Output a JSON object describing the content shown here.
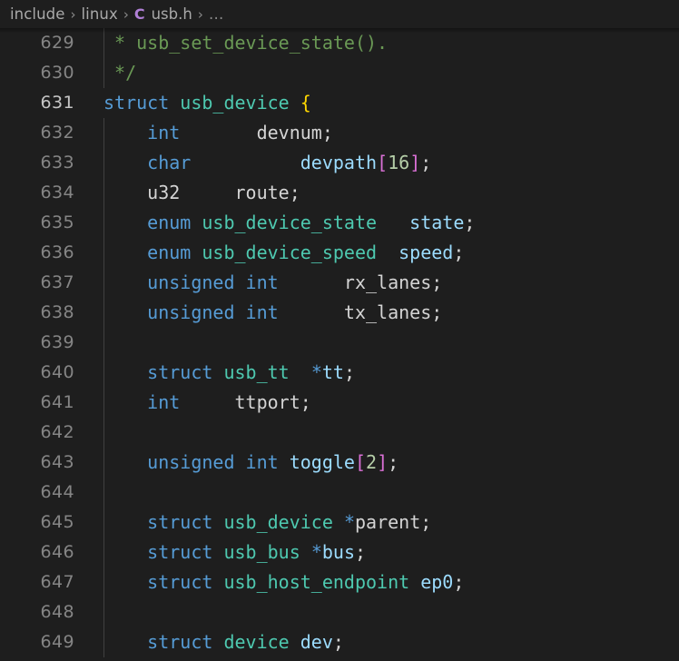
{
  "window": {
    "title": "usb.h — Visual Studio Code",
    "theme": "Dark+ (default dark)",
    "language": "C"
  },
  "breadcrumb": {
    "name": "breadcrumb",
    "separator": "›",
    "items": [
      {
        "label": "include",
        "icon": null
      },
      {
        "label": "linux",
        "icon": null
      },
      {
        "label": "usb.h",
        "icon": "c-file-icon"
      },
      {
        "label": "…",
        "icon": null
      }
    ]
  },
  "colors": {
    "editor_background": "#1e1e1e",
    "breadcrumb_background": "#1e1e1e",
    "line_number": "#858585",
    "line_number_active": "#c6c6c6",
    "indent_guide": "#404040",
    "comment": "#6a9955",
    "keyword": "#569cd6",
    "type": "#4ec9b0",
    "variable": "#9cdcfe",
    "plain_text": "#d4d4d4",
    "number": "#b5cea8",
    "bracket_level_1": "#ffd700",
    "bracket_level_2": "#da70d6",
    "c_file_icon": "#b180d7"
  },
  "editor": {
    "name": "code-editor",
    "file": "usb.h",
    "first_visible_line": 629,
    "last_visible_line": 649,
    "active_line": 631,
    "lines": [
      {
        "number": 629,
        "indent_guide": true,
        "text": " * usb_set_device_state().",
        "tokens": [
          {
            "t": " * usb_set_device_state().",
            "c": "t-comment"
          }
        ]
      },
      {
        "number": 630,
        "indent_guide": true,
        "text": " */",
        "tokens": [
          {
            "t": " */",
            "c": "t-comment"
          }
        ]
      },
      {
        "number": 631,
        "indent_guide": false,
        "text": "struct usb_device {",
        "tokens": [
          {
            "t": "struct",
            "c": "t-keyword"
          },
          {
            "t": " ",
            "c": "t-plain"
          },
          {
            "t": "usb_device",
            "c": "t-type"
          },
          {
            "t": " ",
            "c": "t-plain"
          },
          {
            "t": "{",
            "c": "t-brk1"
          }
        ]
      },
      {
        "number": 632,
        "indent_guide": true,
        "text": "    int\t\tdevnum;",
        "tokens": [
          {
            "t": "    ",
            "c": "t-plain"
          },
          {
            "t": "int",
            "c": "t-keyword"
          },
          {
            "t": "       ",
            "c": "t-plain"
          },
          {
            "t": "devnum",
            "c": "t-plain"
          },
          {
            "t": ";",
            "c": "t-punc"
          }
        ]
      },
      {
        "number": 633,
        "indent_guide": true,
        "text": "    char\t\tdevpath[16];",
        "tokens": [
          {
            "t": "    ",
            "c": "t-plain"
          },
          {
            "t": "char",
            "c": "t-keyword"
          },
          {
            "t": "          ",
            "c": "t-plain"
          },
          {
            "t": "devpath",
            "c": "t-var"
          },
          {
            "t": "[",
            "c": "t-brk2"
          },
          {
            "t": "16",
            "c": "t-num"
          },
          {
            "t": "]",
            "c": "t-brk2"
          },
          {
            "t": ";",
            "c": "t-punc"
          }
        ]
      },
      {
        "number": 634,
        "indent_guide": true,
        "text": "    u32\t\troute;",
        "tokens": [
          {
            "t": "    ",
            "c": "t-plain"
          },
          {
            "t": "u32",
            "c": "t-plain"
          },
          {
            "t": "     ",
            "c": "t-plain"
          },
          {
            "t": "route",
            "c": "t-plain"
          },
          {
            "t": ";",
            "c": "t-punc"
          }
        ]
      },
      {
        "number": 635,
        "indent_guide": true,
        "text": "    enum usb_device_state\tstate;",
        "tokens": [
          {
            "t": "    ",
            "c": "t-plain"
          },
          {
            "t": "enum",
            "c": "t-keyword"
          },
          {
            "t": " ",
            "c": "t-plain"
          },
          {
            "t": "usb_device_state",
            "c": "t-type"
          },
          {
            "t": "   ",
            "c": "t-plain"
          },
          {
            "t": "state",
            "c": "t-var"
          },
          {
            "t": ";",
            "c": "t-punc"
          }
        ]
      },
      {
        "number": 636,
        "indent_guide": true,
        "text": "    enum usb_device_speed\tspeed;",
        "tokens": [
          {
            "t": "    ",
            "c": "t-plain"
          },
          {
            "t": "enum",
            "c": "t-keyword"
          },
          {
            "t": " ",
            "c": "t-plain"
          },
          {
            "t": "usb_device_speed",
            "c": "t-type"
          },
          {
            "t": "  ",
            "c": "t-plain"
          },
          {
            "t": "speed",
            "c": "t-var"
          },
          {
            "t": ";",
            "c": "t-punc"
          }
        ]
      },
      {
        "number": 637,
        "indent_guide": true,
        "text": "    unsigned int\t\trx_lanes;",
        "tokens": [
          {
            "t": "    ",
            "c": "t-plain"
          },
          {
            "t": "unsigned int",
            "c": "t-keyword"
          },
          {
            "t": "      ",
            "c": "t-plain"
          },
          {
            "t": "rx_lanes",
            "c": "t-plain"
          },
          {
            "t": ";",
            "c": "t-punc"
          }
        ]
      },
      {
        "number": 638,
        "indent_guide": true,
        "text": "    unsigned int\t\ttx_lanes;",
        "tokens": [
          {
            "t": "    ",
            "c": "t-plain"
          },
          {
            "t": "unsigned int",
            "c": "t-keyword"
          },
          {
            "t": "      ",
            "c": "t-plain"
          },
          {
            "t": "tx_lanes",
            "c": "t-plain"
          },
          {
            "t": ";",
            "c": "t-punc"
          }
        ]
      },
      {
        "number": 639,
        "indent_guide": true,
        "text": "",
        "tokens": []
      },
      {
        "number": 640,
        "indent_guide": true,
        "text": "    struct usb_tt\t*tt;",
        "tokens": [
          {
            "t": "    ",
            "c": "t-plain"
          },
          {
            "t": "struct",
            "c": "t-keyword"
          },
          {
            "t": " ",
            "c": "t-plain"
          },
          {
            "t": "usb_tt",
            "c": "t-type"
          },
          {
            "t": "  ",
            "c": "t-plain"
          },
          {
            "t": "*",
            "c": "t-keyword"
          },
          {
            "t": "tt",
            "c": "t-var"
          },
          {
            "t": ";",
            "c": "t-punc"
          }
        ]
      },
      {
        "number": 641,
        "indent_guide": true,
        "text": "    int\t\tttport;",
        "tokens": [
          {
            "t": "    ",
            "c": "t-plain"
          },
          {
            "t": "int",
            "c": "t-keyword"
          },
          {
            "t": "     ",
            "c": "t-plain"
          },
          {
            "t": "ttport",
            "c": "t-plain"
          },
          {
            "t": ";",
            "c": "t-punc"
          }
        ]
      },
      {
        "number": 642,
        "indent_guide": true,
        "text": "",
        "tokens": []
      },
      {
        "number": 643,
        "indent_guide": true,
        "text": "    unsigned int toggle[2];",
        "tokens": [
          {
            "t": "    ",
            "c": "t-plain"
          },
          {
            "t": "unsigned int",
            "c": "t-keyword"
          },
          {
            "t": " ",
            "c": "t-plain"
          },
          {
            "t": "toggle",
            "c": "t-var"
          },
          {
            "t": "[",
            "c": "t-brk2"
          },
          {
            "t": "2",
            "c": "t-num"
          },
          {
            "t": "]",
            "c": "t-brk2"
          },
          {
            "t": ";",
            "c": "t-punc"
          }
        ]
      },
      {
        "number": 644,
        "indent_guide": true,
        "text": "",
        "tokens": []
      },
      {
        "number": 645,
        "indent_guide": true,
        "text": "    struct usb_device *parent;",
        "tokens": [
          {
            "t": "    ",
            "c": "t-plain"
          },
          {
            "t": "struct",
            "c": "t-keyword"
          },
          {
            "t": " ",
            "c": "t-plain"
          },
          {
            "t": "usb_device",
            "c": "t-type"
          },
          {
            "t": " ",
            "c": "t-plain"
          },
          {
            "t": "*",
            "c": "t-keyword"
          },
          {
            "t": "parent",
            "c": "t-plain"
          },
          {
            "t": ";",
            "c": "t-punc"
          }
        ]
      },
      {
        "number": 646,
        "indent_guide": true,
        "text": "    struct usb_bus *bus;",
        "tokens": [
          {
            "t": "    ",
            "c": "t-plain"
          },
          {
            "t": "struct",
            "c": "t-keyword"
          },
          {
            "t": " ",
            "c": "t-plain"
          },
          {
            "t": "usb_bus",
            "c": "t-type"
          },
          {
            "t": " ",
            "c": "t-plain"
          },
          {
            "t": "*",
            "c": "t-keyword"
          },
          {
            "t": "bus",
            "c": "t-var"
          },
          {
            "t": ";",
            "c": "t-punc"
          }
        ]
      },
      {
        "number": 647,
        "indent_guide": true,
        "text": "    struct usb_host_endpoint ep0;",
        "tokens": [
          {
            "t": "    ",
            "c": "t-plain"
          },
          {
            "t": "struct",
            "c": "t-keyword"
          },
          {
            "t": " ",
            "c": "t-plain"
          },
          {
            "t": "usb_host_endpoint",
            "c": "t-type"
          },
          {
            "t": " ",
            "c": "t-plain"
          },
          {
            "t": "ep0",
            "c": "t-var"
          },
          {
            "t": ";",
            "c": "t-punc"
          }
        ]
      },
      {
        "number": 648,
        "indent_guide": true,
        "text": "",
        "tokens": []
      },
      {
        "number": 649,
        "indent_guide": true,
        "text": "    struct device dev;",
        "tokens": [
          {
            "t": "    ",
            "c": "t-plain"
          },
          {
            "t": "struct",
            "c": "t-keyword"
          },
          {
            "t": " ",
            "c": "t-plain"
          },
          {
            "t": "device",
            "c": "t-type"
          },
          {
            "t": " ",
            "c": "t-plain"
          },
          {
            "t": "dev",
            "c": "t-var"
          },
          {
            "t": ";",
            "c": "t-punc"
          }
        ]
      }
    ]
  }
}
